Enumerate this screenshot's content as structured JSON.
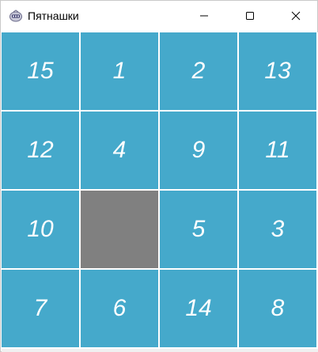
{
  "window": {
    "title": "Пятнашки",
    "icon": "app-icon"
  },
  "controls": {
    "minimize_icon": "minimize-icon",
    "maximize_icon": "maximize-icon",
    "close_icon": "close-icon"
  },
  "colors": {
    "tile": "#45a9cb",
    "empty_tile": "#808080",
    "tile_text": "#ffffff",
    "grid_line": "#ffffff"
  },
  "board": {
    "rows": [
      [
        "15",
        "1",
        "2",
        "13"
      ],
      [
        "12",
        "4",
        "9",
        "11"
      ],
      [
        "10",
        "",
        "5",
        "3"
      ],
      [
        "7",
        "6",
        "14",
        "8"
      ]
    ]
  }
}
